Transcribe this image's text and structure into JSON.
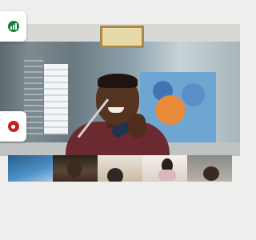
{
  "main_video": {
    "participant": "speaker"
  },
  "controls": {
    "stats_icon": "stats-icon",
    "record_icon": "record-icon",
    "colors": {
      "stats": "#188038",
      "record": "#c5221f"
    }
  },
  "participants": [
    {
      "icon": "participant-video"
    },
    {
      "icon": "participant-video"
    },
    {
      "icon": "participant-video"
    },
    {
      "icon": "participant-video"
    },
    {
      "icon": "participant-video"
    }
  ]
}
